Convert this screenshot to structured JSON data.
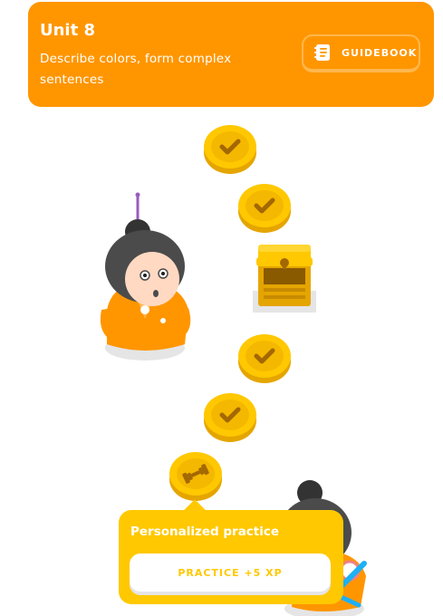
{
  "unit": {
    "title": "Unit 8",
    "description": "Describe colors, form complex sentences",
    "guidebook_label": "GUIDEBOOK"
  },
  "path": {
    "nodes": [
      {
        "state": "completed",
        "icon": "check-icon"
      },
      {
        "state": "completed",
        "icon": "check-icon"
      },
      {
        "state": "chest",
        "icon": "treasure-chest-icon"
      },
      {
        "state": "completed",
        "icon": "check-icon"
      },
      {
        "state": "completed",
        "icon": "check-icon"
      },
      {
        "state": "current",
        "icon": "dumbbell-icon"
      }
    ]
  },
  "popup": {
    "title": "Personalized practice",
    "button_label": "PRACTICE +5 XP"
  },
  "colors": {
    "unit_bg": "#ff9600",
    "gold": "#ffc800",
    "gold_dark": "#e5a500",
    "popup_bg": "#ffc800"
  }
}
